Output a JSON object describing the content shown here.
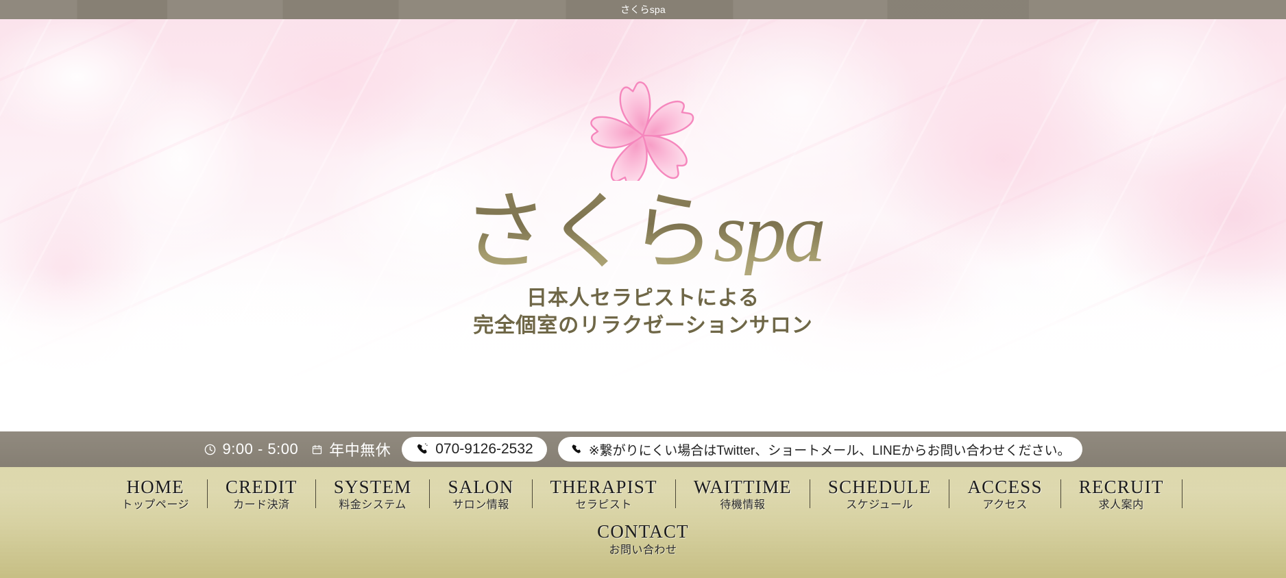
{
  "window": {
    "title": "さくらspa"
  },
  "hero": {
    "logo_icon": "sakura-blossom-icon",
    "wordmark_ja": "さくら",
    "wordmark_latin": "spa",
    "tagline_line1": "日本人セラピストによる",
    "tagline_line2": "完全個室のリラクゼーションサロン",
    "colors": {
      "wordmark_gold": "#8b8059",
      "petal_pink": "#f7a8cb",
      "petal_fill": "#fbcbe0"
    }
  },
  "infobar": {
    "clock_icon": "clock-icon",
    "hours": "9:00 - 5:00",
    "calendar_icon": "calendar-icon",
    "holiday": "年中無休",
    "phone_icon": "phone-icon",
    "phone": "070-9126-2532",
    "note_icon": "phone-icon",
    "note": "※繋がりにくい場合はTwitter、ショートメール、LINEからお問い合わせください。",
    "background": "#8b8478"
  },
  "nav": {
    "background_top": "#ddd8ab",
    "background_bottom": "#c6be82",
    "items": [
      {
        "en": "HOME",
        "ja": "トップページ"
      },
      {
        "en": "CREDIT",
        "ja": "カード決済"
      },
      {
        "en": "SYSTEM",
        "ja": "料金システム"
      },
      {
        "en": "SALON",
        "ja": "サロン情報"
      },
      {
        "en": "THERAPIST",
        "ja": "セラピスト"
      },
      {
        "en": "WAITTIME",
        "ja": "待機情報"
      },
      {
        "en": "SCHEDULE",
        "ja": "スケジュール"
      },
      {
        "en": "ACCESS",
        "ja": "アクセス"
      },
      {
        "en": "RECRUIT",
        "ja": "求人案内"
      }
    ],
    "second_row": [
      {
        "en": "CONTACT",
        "ja": "お問い合わせ"
      }
    ]
  }
}
